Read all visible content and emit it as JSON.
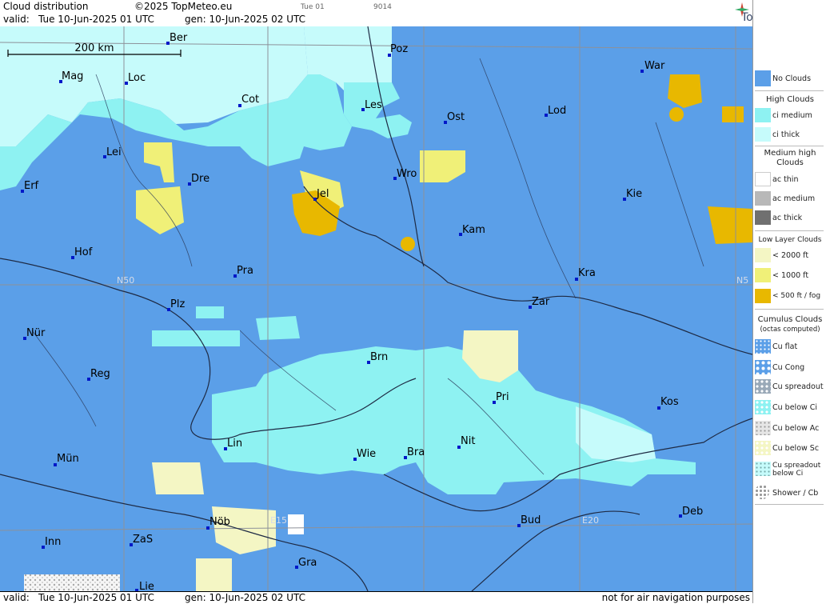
{
  "header": {
    "title": "Cloud distribution",
    "copyright": "©2025 TopMeteo.eu",
    "valid_label": "valid:",
    "valid": "Tue  10-Jun-2025  01 UTC",
    "gen": "gen: 10-Jun-2025 02 UTC",
    "tab": "Tue 01",
    "code": "9014",
    "logo": "TopMeteo"
  },
  "footer": {
    "valid_label": "valid:",
    "valid": "Tue  10-Jun-2025  01 UTC",
    "gen": "gen: 10-Jun-2025 02 UTC",
    "disclaimer": "not for air navigation purposes"
  },
  "map": {
    "scale_label": "200 km",
    "grid_labels": [
      "N50",
      "N5",
      "E15",
      "E20"
    ],
    "cities": [
      "Ber",
      "Poz",
      "Mag",
      "Loc",
      "War",
      "Cot",
      "Les",
      "Ost",
      "Lod",
      "Lei",
      "Erf",
      "Dre",
      "Wro",
      "Jel",
      "Kie",
      "Kam",
      "Hof",
      "Pra",
      "Kra",
      "Zar",
      "Plz",
      "Nür",
      "Brn",
      "Reg",
      "Pri",
      "Kos",
      "Lin",
      "Wie",
      "Bra",
      "Nit",
      "Mün",
      "Inn",
      "ZaS",
      "Nöb",
      "Bud",
      "Deb",
      "Gra",
      "Lie"
    ]
  },
  "legend": {
    "no_clouds": "No Clouds",
    "high_title": "High Clouds",
    "ci_medium": "ci medium",
    "ci_thick": "ci thick",
    "medium_title": "Medium high Clouds",
    "ac_thin": "ac thin",
    "ac_medium": "ac medium",
    "ac_thick": "ac thick",
    "low_title": "Low Layer Clouds",
    "low_2000": "< 2000 ft",
    "low_1000": "< 1000 ft",
    "low_500": "< 500 ft / fog",
    "cu_title": "Cumulus Clouds",
    "cu_sub": "(octas computed)",
    "cu_flat": "Cu flat",
    "cu_cong": "Cu Cong",
    "cu_spreadout": "Cu spreadout",
    "cu_below_ci": "Cu below Ci",
    "cu_below_ac": "Cu below Ac",
    "cu_below_sc": "Cu below Sc",
    "cu_spread_ci": "Cu spreadout below Ci",
    "shower": "Shower / Cb"
  },
  "colors": {
    "no_clouds": "#5b9fe8",
    "ci_medium": "#8ef2f2",
    "ci_thick": "#c6fbfb",
    "low_2000": "#f4f6c4",
    "low_1000": "#f0f078",
    "low_500": "#e8b800",
    "border": "#1e2a44"
  }
}
